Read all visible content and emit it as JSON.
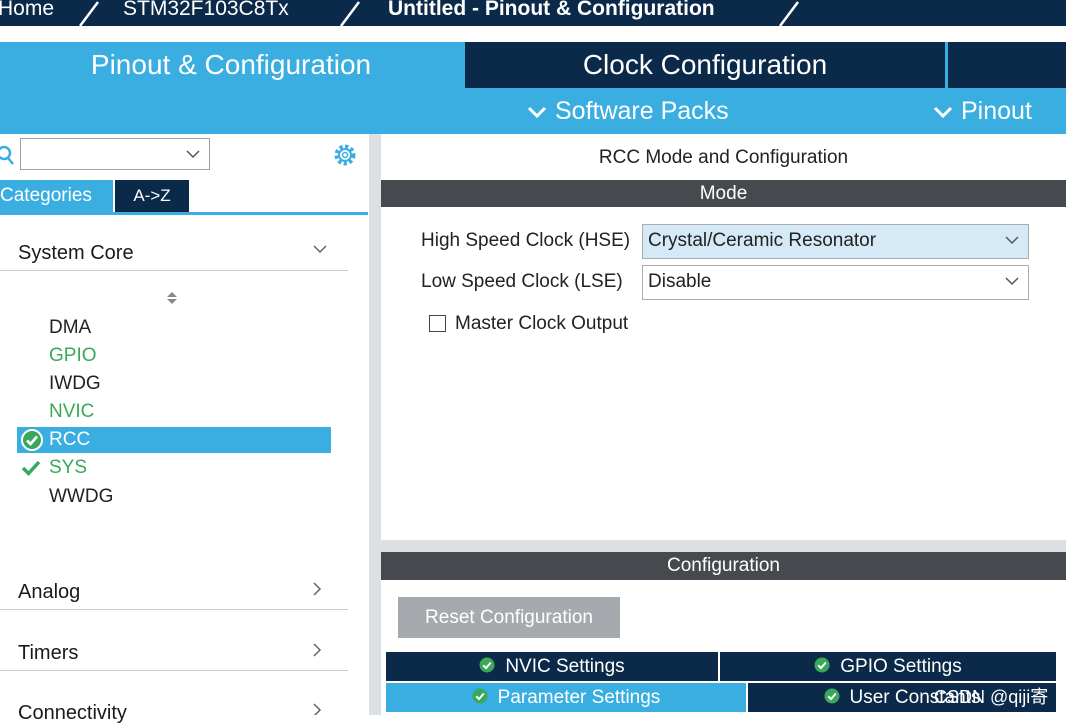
{
  "breadcrumb": {
    "items": [
      "Home",
      "STM32F103C8Tx",
      "Untitled - Pinout & Configuration"
    ]
  },
  "main_tabs": {
    "pinout": "Pinout & Configuration",
    "clock": "Clock Configuration"
  },
  "menu": {
    "software_packs": "Software Packs",
    "pinout": "Pinout"
  },
  "left": {
    "search_placeholder": "",
    "tabs": {
      "categories": "Categories",
      "az": "A->Z"
    },
    "categories": [
      "System Core",
      "Analog",
      "Timers",
      "Connectivity"
    ],
    "system_core_items": [
      {
        "label": "DMA",
        "state": "normal"
      },
      {
        "label": "GPIO",
        "state": "green"
      },
      {
        "label": "IWDG",
        "state": "normal"
      },
      {
        "label": "NVIC",
        "state": "green"
      },
      {
        "label": "RCC",
        "state": "selected-ok"
      },
      {
        "label": "SYS",
        "state": "green-check"
      },
      {
        "label": "WWDG",
        "state": "normal"
      }
    ]
  },
  "right": {
    "title": "RCC Mode and Configuration",
    "mode_header": "Mode",
    "hse": {
      "label": "High Speed Clock (HSE)",
      "value": "Crystal/Ceramic Resonator"
    },
    "lse": {
      "label": "Low Speed Clock (LSE)",
      "value": "Disable"
    },
    "mco": {
      "label": "Master Clock Output",
      "checked": false
    },
    "config_header": "Configuration",
    "reset_button": "Reset Configuration",
    "subtabs": {
      "nvic": "NVIC Settings",
      "gpio": "GPIO Settings",
      "param": "Parameter Settings",
      "user": "User Constants"
    }
  },
  "watermark": "CSDN @qiji寄",
  "colors": {
    "accent": "#3aaee0",
    "navy": "#0b2a4a",
    "header_gray": "#464a4e",
    "ok_green": "#3aa85a"
  }
}
